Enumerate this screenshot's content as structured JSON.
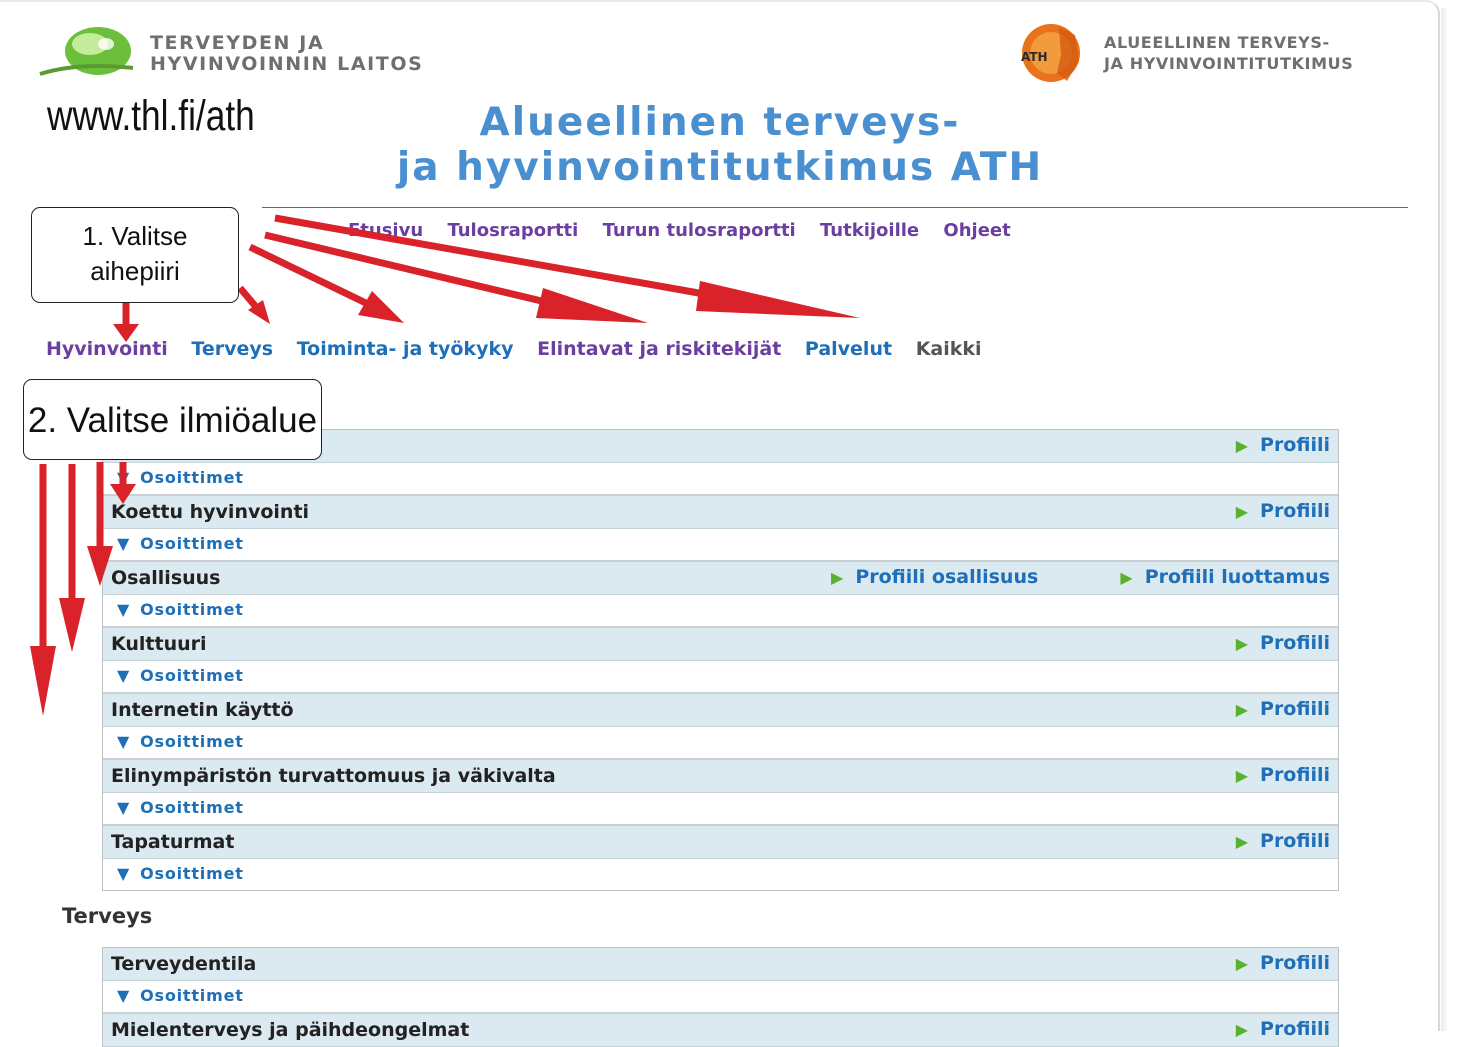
{
  "header": {
    "thl_line1": "TERVEYDEN JA",
    "thl_line2": "HYVINVOINNIN LAITOS",
    "ath_line1": "ALUEELLINEN TERVEYS-",
    "ath_line2": "JA HYVINVOINTITUTKIMUS",
    "ath_logo_label": "ATH",
    "url": "www.thl.fi/ath",
    "title_line1": "Alueellinen terveys-",
    "title_line2": "ja hyvinvointitutkimus ATH"
  },
  "top_nav": [
    "Etusivu",
    "Tulosraportti",
    "Turun tulosraportti",
    "Tutkijoille",
    "Ohjeet"
  ],
  "categories": [
    {
      "label": "Hyvinvointi",
      "color": "#6b3fa0"
    },
    {
      "label": "Terveys",
      "color": "#1f6fb8"
    },
    {
      "label": "Toiminta- ja työkyky",
      "color": "#1f6fb8"
    },
    {
      "label": "Elintavat ja riskitekijät",
      "color": "#6b3fa0"
    },
    {
      "label": "Palvelut",
      "color": "#1f6fb8"
    },
    {
      "label": "Kaikki",
      "color": "#555555"
    }
  ],
  "callouts": {
    "step1_line1": "1. Valitse",
    "step1_line2": "aihepiiri",
    "step2": "2. Valitse ilmiöalue"
  },
  "table1": {
    "rows": [
      {
        "name": "",
        "profiles": [
          "Profiili"
        ],
        "sub": "Osoittimet"
      },
      {
        "name": "Koettu hyvinvointi",
        "profiles": [
          "Profiili"
        ],
        "sub": "Osoittimet"
      },
      {
        "name": "Osallisuus",
        "profiles": [
          "Profiili osallisuus",
          "Profiili luottamus"
        ],
        "sub": "Osoittimet"
      },
      {
        "name": "Kulttuuri",
        "profiles": [
          "Profiili"
        ],
        "sub": "Osoittimet"
      },
      {
        "name": "Internetin käyttö",
        "profiles": [
          "Profiili"
        ],
        "sub": "Osoittimet"
      },
      {
        "name": "Elinympäristön turvattomuus ja väkivalta",
        "profiles": [
          "Profiili"
        ],
        "sub": "Osoittimet"
      },
      {
        "name": "Tapaturmat",
        "profiles": [
          "Profiili"
        ],
        "sub": "Osoittimet"
      }
    ]
  },
  "section2_title": "Terveys",
  "table2": {
    "rows": [
      {
        "name": "Terveydentila",
        "profiles": [
          "Profiili"
        ],
        "sub": "Osoittimet"
      },
      {
        "name": "Mielenterveys ja päihdeongelmat",
        "profiles": [
          "Profiili"
        ],
        "sub": ""
      }
    ]
  },
  "colors": {
    "accent_blue": "#1f6fb8",
    "accent_purple": "#6b3fa0",
    "row_header_bg": "#dbeaf0",
    "arrow_red": "#d9222a",
    "play_green": "#5bb12f"
  }
}
